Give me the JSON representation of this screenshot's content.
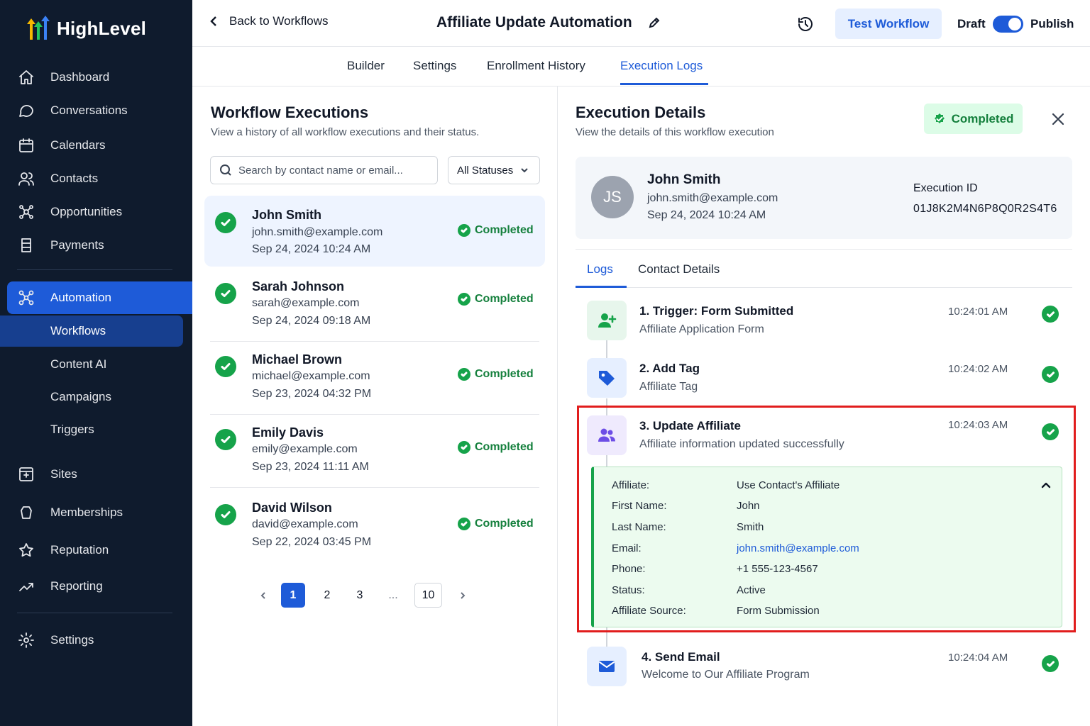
{
  "brand": {
    "name": "HighLevel"
  },
  "sidebar": {
    "items": [
      {
        "label": "Dashboard",
        "icon": "home-icon"
      },
      {
        "label": "Conversations",
        "icon": "chat-icon"
      },
      {
        "label": "Calendars",
        "icon": "calendar-icon"
      },
      {
        "label": "Contacts",
        "icon": "users-icon"
      },
      {
        "label": "Opportunities",
        "icon": "pipeline-icon"
      },
      {
        "label": "Payments",
        "icon": "payments-icon"
      },
      {
        "label": "Automation",
        "icon": "automation-icon",
        "active": true
      },
      {
        "label": "Sites",
        "icon": "sites-icon"
      },
      {
        "label": "Memberships",
        "icon": "membership-icon"
      },
      {
        "label": "Reputation",
        "icon": "star-icon"
      },
      {
        "label": "Reporting",
        "icon": "chart-line-icon"
      },
      {
        "label": "Settings",
        "icon": "gear-icon"
      }
    ],
    "sub_items": [
      "Workflows",
      "Content AI",
      "Campaigns",
      "Triggers"
    ],
    "active_sub": "Workflows"
  },
  "header": {
    "back_label": "Back to Workflows",
    "title": "Affiliate Update Automation",
    "test_button": "Test Workflow",
    "draft_label": "Draft",
    "publish_label": "Publish",
    "publish_on": true
  },
  "tabs": [
    "Builder",
    "Settings",
    "Enrollment History",
    "Execution Logs"
  ],
  "active_tab": "Execution Logs",
  "executions_panel": {
    "title": "Workflow Executions",
    "subtitle": "View a history of all workflow executions and their status.",
    "search_placeholder": "Search by contact name or email...",
    "status_filter": "All Statuses",
    "rows": [
      {
        "name": "John Smith",
        "email": "john.smith@example.com",
        "date": "Sep 24, 2024 10:24 AM",
        "status": "Completed"
      },
      {
        "name": "Sarah Johnson",
        "email": "sarah@example.com",
        "date": "Sep 24, 2024 09:18 AM",
        "status": "Completed"
      },
      {
        "name": "Michael Brown",
        "email": "michael@example.com",
        "date": "Sep 23, 2024 04:32 PM",
        "status": "Completed"
      },
      {
        "name": "Emily Davis",
        "email": "emily@example.com",
        "date": "Sep 23, 2024 11:11 AM",
        "status": "Completed"
      },
      {
        "name": "David Wilson",
        "email": "david@example.com",
        "date": "Sep 22, 2024 03:45 PM",
        "status": "Completed"
      }
    ],
    "pagination": {
      "current": "1",
      "pages": [
        "1",
        "2",
        "3",
        "...",
        "10"
      ]
    }
  },
  "details_panel": {
    "title": "Execution Details",
    "subtitle": "View the details of this workflow execution",
    "status_badge": "Completed",
    "contact": {
      "initials": "JS",
      "name": "John Smith",
      "email": "john.smith@example.com",
      "date": "Sep 24, 2024 10:24 AM",
      "execution_id_label": "Execution ID",
      "execution_id": "01J8K2M4N6P8Q0R2S4T6"
    },
    "tabs": [
      "Logs",
      "Contact Details"
    ],
    "active_tab": "Logs",
    "steps": [
      {
        "title": "1. Trigger: Form Submitted",
        "subtitle": "Affiliate Application Form",
        "time": "10:24:01 AM",
        "icon": "user-plus-icon"
      },
      {
        "title": "2. Add Tag",
        "subtitle": "Affiliate Tag",
        "time": "10:24:02 AM",
        "icon": "tag-icon"
      },
      {
        "title": "3. Update Affiliate",
        "subtitle": "Affiliate information updated successfully",
        "time": "10:24:03 AM",
        "icon": "users-icon"
      },
      {
        "title": "4. Send Email",
        "subtitle": "Welcome to Our Affiliate Program",
        "time": "10:24:04 AM",
        "icon": "mail-icon"
      }
    ],
    "update_details": [
      {
        "key": "Affiliate:",
        "value": "Use Contact's Affiliate"
      },
      {
        "key": "First Name:",
        "value": "John"
      },
      {
        "key": "Last Name:",
        "value": "Smith"
      },
      {
        "key": "Email:",
        "value": "john.smith@example.com"
      },
      {
        "key": "Phone:",
        "value": "+1 555-123-4567"
      },
      {
        "key": "Status:",
        "value": "Active"
      },
      {
        "key": "Affiliate Source:",
        "value": "Form Submission"
      }
    ]
  },
  "colors": {
    "sidebar_bg": "#0f1b2d",
    "accent": "#1e5bd8",
    "success": "#16a34a",
    "highlight": "#e11d1d"
  }
}
